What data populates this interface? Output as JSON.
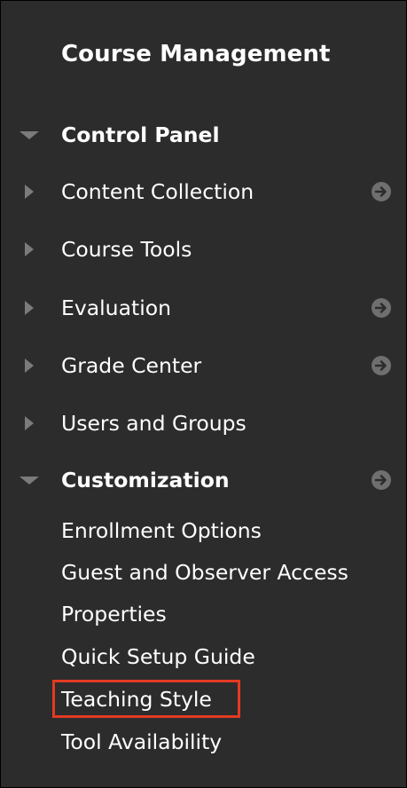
{
  "panel": {
    "title": "Course Management",
    "control_panel": {
      "label": "Control Panel",
      "items": [
        {
          "label": "Content Collection",
          "has_arrow": true
        },
        {
          "label": "Course Tools",
          "has_arrow": false
        },
        {
          "label": "Evaluation",
          "has_arrow": true
        },
        {
          "label": "Grade Center",
          "has_arrow": true
        },
        {
          "label": "Users and Groups",
          "has_arrow": false
        }
      ]
    },
    "customization": {
      "label": "Customization",
      "items": [
        "Enrollment Options",
        "Guest and Observer Access",
        "Properties",
        "Quick Setup Guide",
        "Teaching Style",
        "Tool Availability"
      ],
      "highlighted_item": "Teaching Style"
    }
  },
  "colors": {
    "panel_bg": "#2c2c2c",
    "text": "#ffffff",
    "icon_gray": "#7b7b7b",
    "highlight_border": "#e23a22"
  },
  "icons": {
    "expanded": "triangle-down-icon",
    "collapsed": "triangle-right-icon",
    "go": "arrow-circle-right-icon"
  }
}
